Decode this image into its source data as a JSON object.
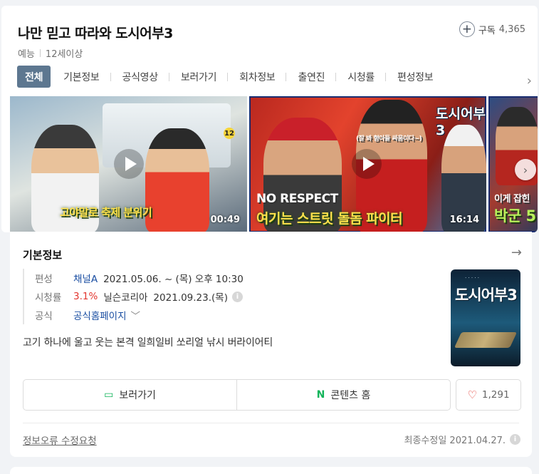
{
  "header": {
    "title": "나만 믿고 따라와 도시어부3",
    "genre": "예능",
    "rating": "12세이상",
    "subscribe_label": "구독",
    "subscribe_count": "4,365"
  },
  "tabs": [
    "전체",
    "기본정보",
    "공식영상",
    "보러가기",
    "회차정보",
    "출연진",
    "시청률",
    "편성정보"
  ],
  "videos": [
    {
      "caption": "고야말로 축제 분위기",
      "duration": "00:49",
      "badge": "12"
    },
    {
      "caption_top": "NO RESPECT",
      "caption": "여기는 스트릿 돌돔 파이터",
      "subcaption": "(잘 봐 형아들 싸움이다~)",
      "duration": "16:14",
      "logo": "도시어부3"
    },
    {
      "caption_top": "이게 잡힌",
      "caption": "박군 5"
    }
  ],
  "basic_info": {
    "section_title": "기본정보",
    "rows": [
      {
        "label": "편성",
        "channel": "채널A",
        "schedule": "2021.05.06. ~  (목) 오후 10:30"
      },
      {
        "label": "시청률",
        "value": "3.1%",
        "source": "닐슨코리아",
        "date": "2021.09.23.(목)"
      },
      {
        "label": "공식",
        "link": "공식홈페이지"
      }
    ],
    "description": "고기 하나에 울고 웃는 본격 일희일비 쏘리얼 낚시 버라이어티",
    "poster_title": "도시어부3"
  },
  "actions": {
    "watch_label": "보러가기",
    "content_home_label": "콘텐츠 홈",
    "like_count": "1,291"
  },
  "footer": {
    "report_label": "정보오류 수정요청",
    "updated": "최종수정일 2021.04.27."
  },
  "colors": {
    "tab_active": "#5d7790",
    "link": "#1a4ea2",
    "rating_red": "#e3362f",
    "naver_green": "#12b45a"
  }
}
